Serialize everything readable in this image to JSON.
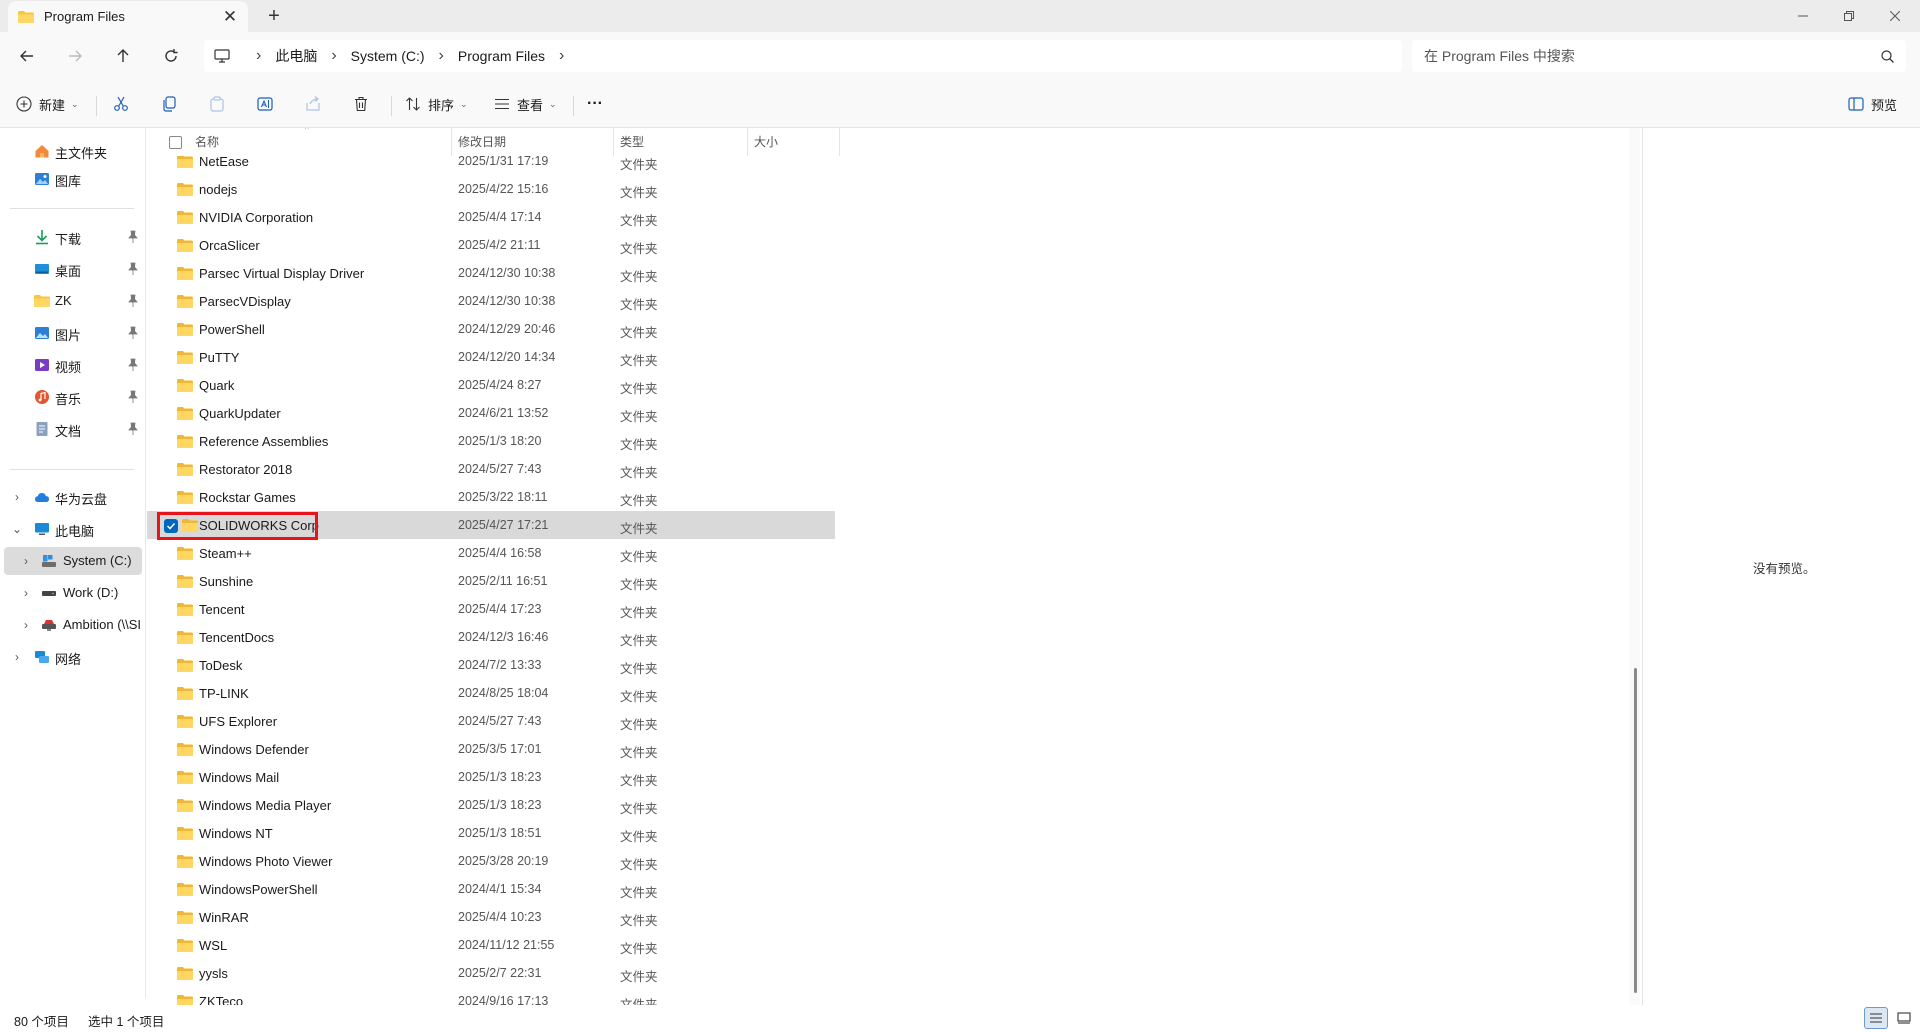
{
  "window": {
    "tab_title": "Program Files",
    "tab_close": "✕",
    "new_tab": "+"
  },
  "address": {
    "breadcrumbs": [
      "此电脑",
      "System (C:)",
      "Program Files"
    ],
    "search_placeholder": "在 Program Files 中搜索"
  },
  "commands": {
    "new_label": "新建",
    "sort_label": "排序",
    "view_label": "查看",
    "more": "···",
    "preview_label": "预览"
  },
  "nav": {
    "items": [
      {
        "label": "主文件夹",
        "icon": "home-icon"
      },
      {
        "label": "图库",
        "icon": "gallery-icon"
      },
      {
        "label": "下载",
        "icon": "download-icon",
        "pinned": true
      },
      {
        "label": "桌面",
        "icon": "desktop-icon",
        "pinned": true
      },
      {
        "label": "ZK",
        "icon": "folder-icon",
        "pinned": true
      },
      {
        "label": "图片",
        "icon": "pictures-icon",
        "pinned": true
      },
      {
        "label": "视频",
        "icon": "videos-icon",
        "pinned": true
      },
      {
        "label": "音乐",
        "icon": "music-icon",
        "pinned": true
      },
      {
        "label": "文档",
        "icon": "documents-icon",
        "pinned": true
      },
      {
        "label": "华为云盘",
        "icon": "cloud-icon"
      },
      {
        "label": "此电脑",
        "icon": "this-pc-icon"
      },
      {
        "label": "System (C:)",
        "icon": "drive-c-icon"
      },
      {
        "label": "Work (D:)",
        "icon": "drive-d-icon"
      },
      {
        "label": "Ambition (\\\\SI",
        "icon": "network-drive-icon"
      },
      {
        "label": "网络",
        "icon": "network-icon"
      }
    ]
  },
  "columns": {
    "name": "名称",
    "modified": "修改日期",
    "type": "类型",
    "size": "大小"
  },
  "files": [
    {
      "name": "NetEase",
      "date": "2025/1/31 17:19",
      "type": "文件夹"
    },
    {
      "name": "nodejs",
      "date": "2025/4/22 15:16",
      "type": "文件夹"
    },
    {
      "name": "NVIDIA Corporation",
      "date": "2025/4/4 17:14",
      "type": "文件夹"
    },
    {
      "name": "OrcaSlicer",
      "date": "2025/4/2 21:11",
      "type": "文件夹"
    },
    {
      "name": "Parsec Virtual Display Driver",
      "date": "2024/12/30 10:38",
      "type": "文件夹"
    },
    {
      "name": "ParsecVDisplay",
      "date": "2024/12/30 10:38",
      "type": "文件夹"
    },
    {
      "name": "PowerShell",
      "date": "2024/12/29 20:46",
      "type": "文件夹"
    },
    {
      "name": "PuTTY",
      "date": "2024/12/20 14:34",
      "type": "文件夹"
    },
    {
      "name": "Quark",
      "date": "2025/4/24 8:27",
      "type": "文件夹"
    },
    {
      "name": "QuarkUpdater",
      "date": "2024/6/21 13:52",
      "type": "文件夹"
    },
    {
      "name": "Reference Assemblies",
      "date": "2025/1/3 18:20",
      "type": "文件夹"
    },
    {
      "name": "Restorator 2018",
      "date": "2024/5/27 7:43",
      "type": "文件夹"
    },
    {
      "name": "Rockstar Games",
      "date": "2025/3/22 18:11",
      "type": "文件夹"
    },
    {
      "name": "SOLIDWORKS Corp",
      "date": "2025/4/27 17:21",
      "type": "文件夹",
      "selected": true
    },
    {
      "name": "Steam++",
      "date": "2025/4/4 16:58",
      "type": "文件夹"
    },
    {
      "name": "Sunshine",
      "date": "2025/2/11 16:51",
      "type": "文件夹"
    },
    {
      "name": "Tencent",
      "date": "2025/4/4 17:23",
      "type": "文件夹"
    },
    {
      "name": "TencentDocs",
      "date": "2024/12/3 16:46",
      "type": "文件夹"
    },
    {
      "name": "ToDesk",
      "date": "2024/7/2 13:33",
      "type": "文件夹"
    },
    {
      "name": "TP-LINK",
      "date": "2024/8/25 18:04",
      "type": "文件夹"
    },
    {
      "name": "UFS Explorer",
      "date": "2024/5/27 7:43",
      "type": "文件夹"
    },
    {
      "name": "Windows Defender",
      "date": "2025/3/5 17:01",
      "type": "文件夹"
    },
    {
      "name": "Windows Mail",
      "date": "2025/1/3 18:23",
      "type": "文件夹"
    },
    {
      "name": "Windows Media Player",
      "date": "2025/1/3 18:23",
      "type": "文件夹"
    },
    {
      "name": "Windows NT",
      "date": "2025/1/3 18:51",
      "type": "文件夹"
    },
    {
      "name": "Windows Photo Viewer",
      "date": "2025/3/28 20:19",
      "type": "文件夹"
    },
    {
      "name": "WindowsPowerShell",
      "date": "2024/4/1 15:34",
      "type": "文件夹"
    },
    {
      "name": "WinRAR",
      "date": "2025/4/4 10:23",
      "type": "文件夹"
    },
    {
      "name": "WSL",
      "date": "2024/11/12 21:55",
      "type": "文件夹"
    },
    {
      "name": "yysls",
      "date": "2025/2/7 22:31",
      "type": "文件夹"
    },
    {
      "name": "ZKTeco",
      "date": "2024/9/16 17:13",
      "type": "文件夹"
    }
  ],
  "preview": {
    "empty_text": "没有预览。"
  },
  "status": {
    "item_count": "80 个项目",
    "selection": "选中 1 个项目"
  },
  "colors": {
    "accent": "#0067c0",
    "folder": "#f6c544",
    "highlight": "#e8141c"
  }
}
